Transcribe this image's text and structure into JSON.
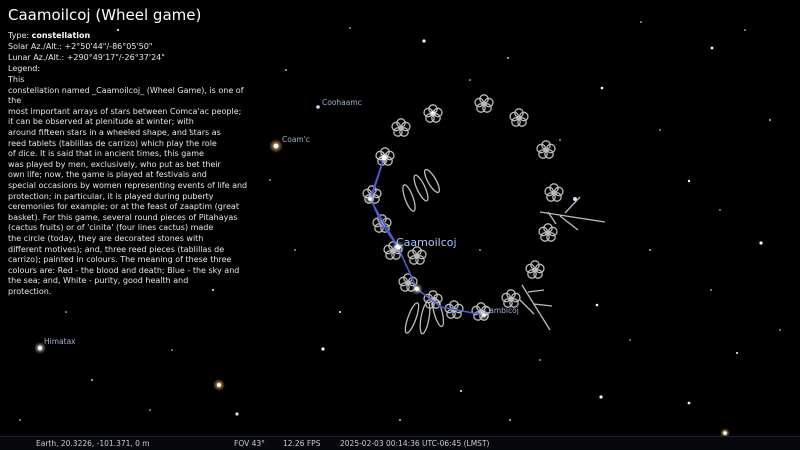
{
  "object": {
    "name": "Caamoilcoj (Wheel game)",
    "type_label": "Type:",
    "type_value": "constellation",
    "solar_azalt": "Solar Az./Alt.: +2°50'44\"/-86°05'50\"",
    "lunar_azalt": "Lunar Az./Alt.: +290°49'17\"/-26°37'24\"",
    "legend_label": "Legend:",
    "description": "This\nconstellation named _Caamoilcoj_ (Wheel Game), is one of the\nmost important arrays of stars between Comca'ac people;\nit can be observed at plenitude at winter; with\naround fifteen stars in a wheeled shape, and stars as\nreed tablets (tablillas de carrizo) which play the role\nof dice. It is said that in ancient times, this game\nwas played by men, exclusively, who put as bet their\nown life; now, the game is played at festivals and\nspecial occasions by women representing events of life and\nprotection; in particular, it is played during puberty\nceremonies for example; or at the feast of zaaptim (great\nbasket). For this game, several round pieces of Pitahayas\n(cactus fruits) or of 'cinita' (four lines cactus) made\nthe circle (today, they are decorated stones with\ndifferent motives); and, three reed pieces (tablillas de\ncarrizo); painted in colours. The meaning of these three\ncolours are: Red - the blood and death; Blue - the sky and\nthe sea; and, White - purity, good health and\nprotection."
  },
  "sky_labels": {
    "coohaamc": "Coohaamc",
    "coamc": "Coam'c",
    "himatax": "Himatax",
    "cambicoj": "Cambicoj",
    "constellation": "Caamoilcoj"
  },
  "statusbar": {
    "location": "Earth, 20.3226, -101.371, 0 m",
    "fov": "FOV 43°",
    "fps": "12.26 FPS",
    "datetime": "2025-02-03 00:14:36 UTC-06:45 (LMST)"
  },
  "colors": {
    "background": "#000000",
    "constellation_line": "#4a5dcc",
    "artwork": "#bdbdbd",
    "label": "#9fb0d8"
  }
}
